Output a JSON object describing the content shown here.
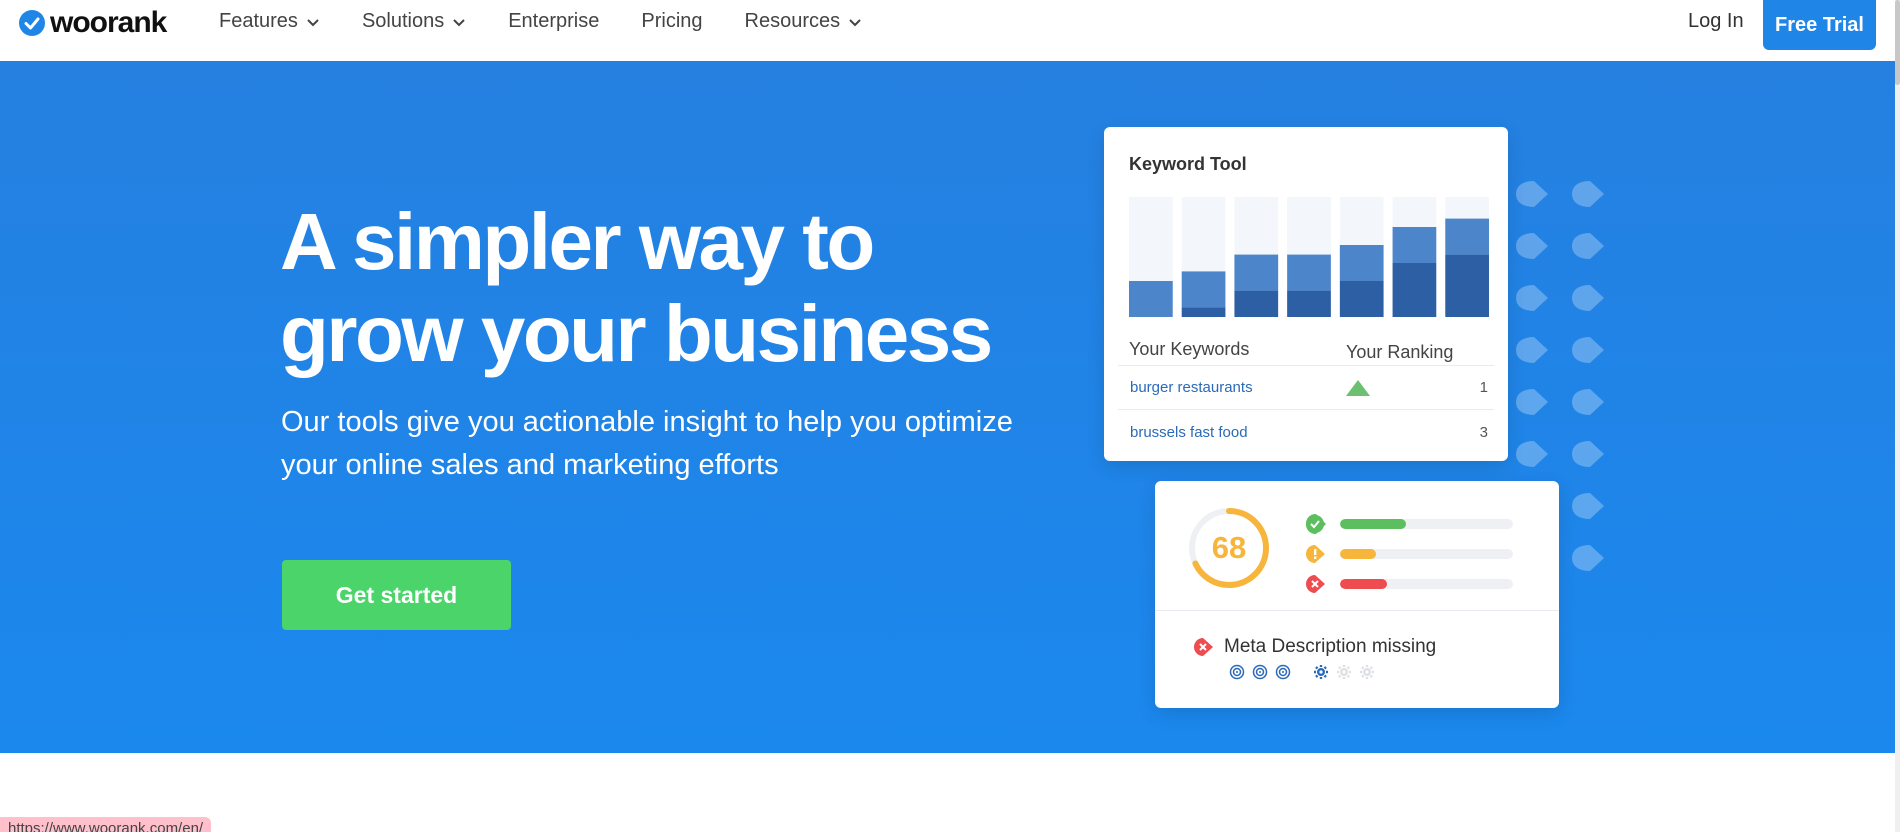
{
  "brand": {
    "name": "woorank",
    "accent": "#1f86e8",
    "hero_bg": "#1b88ee",
    "cta_color": "#4ad469"
  },
  "nav": {
    "items": [
      {
        "label": "Features",
        "dropdown": true,
        "icon": "chevron-down-icon"
      },
      {
        "label": "Solutions",
        "dropdown": true,
        "icon": "chevron-down-icon"
      },
      {
        "label": "Enterprise",
        "dropdown": false
      },
      {
        "label": "Pricing",
        "dropdown": false
      },
      {
        "label": "Resources",
        "dropdown": true,
        "icon": "chevron-down-icon"
      }
    ],
    "login_label": "Log In",
    "trial_label": "Free Trial"
  },
  "hero": {
    "headline_line1": "A simpler way to",
    "headline_line2": "grow your business",
    "subline_line1": "Our tools give you actionable insight to help you optimize",
    "subline_line2": "your online sales and marketing efforts",
    "cta_label": "Get started"
  },
  "keyword_card": {
    "title": "Keyword Tool",
    "chart_data": {
      "type": "bar",
      "categories": [
        "1",
        "2",
        "3",
        "4",
        "5",
        "6",
        "7"
      ],
      "series": [
        {
          "values": [
            0,
            8,
            22,
            22,
            30,
            45,
            52
          ]
        },
        {
          "values": [
            30,
            30,
            30,
            30,
            30,
            30,
            30
          ]
        }
      ],
      "ylim": [
        0,
        100
      ]
    },
    "col_keywords": "Your Keywords",
    "col_ranking": "Your Ranking",
    "rows": [
      {
        "keyword": "burger restaurants",
        "rank": "1",
        "trend": "up"
      },
      {
        "keyword": "brussels fast food",
        "rank": "3",
        "trend": ""
      }
    ]
  },
  "score_card": {
    "score": "68",
    "score_fraction": 0.68,
    "score_color": "#f7b53b",
    "bars": [
      {
        "status": "pass",
        "icon": "check-icon",
        "color": "#5cbf5f",
        "fill": 0.38
      },
      {
        "status": "warning",
        "icon": "warning-icon",
        "color": "#f7b53b",
        "fill": 0.21
      },
      {
        "status": "error",
        "icon": "error-icon",
        "color": "#ee4c4f",
        "fill": 0.27
      }
    ],
    "issue_text": "Meta Description missing",
    "issue_icon": "error-icon"
  },
  "status_bar": {
    "url": "https://www.woorank.com/en/"
  }
}
